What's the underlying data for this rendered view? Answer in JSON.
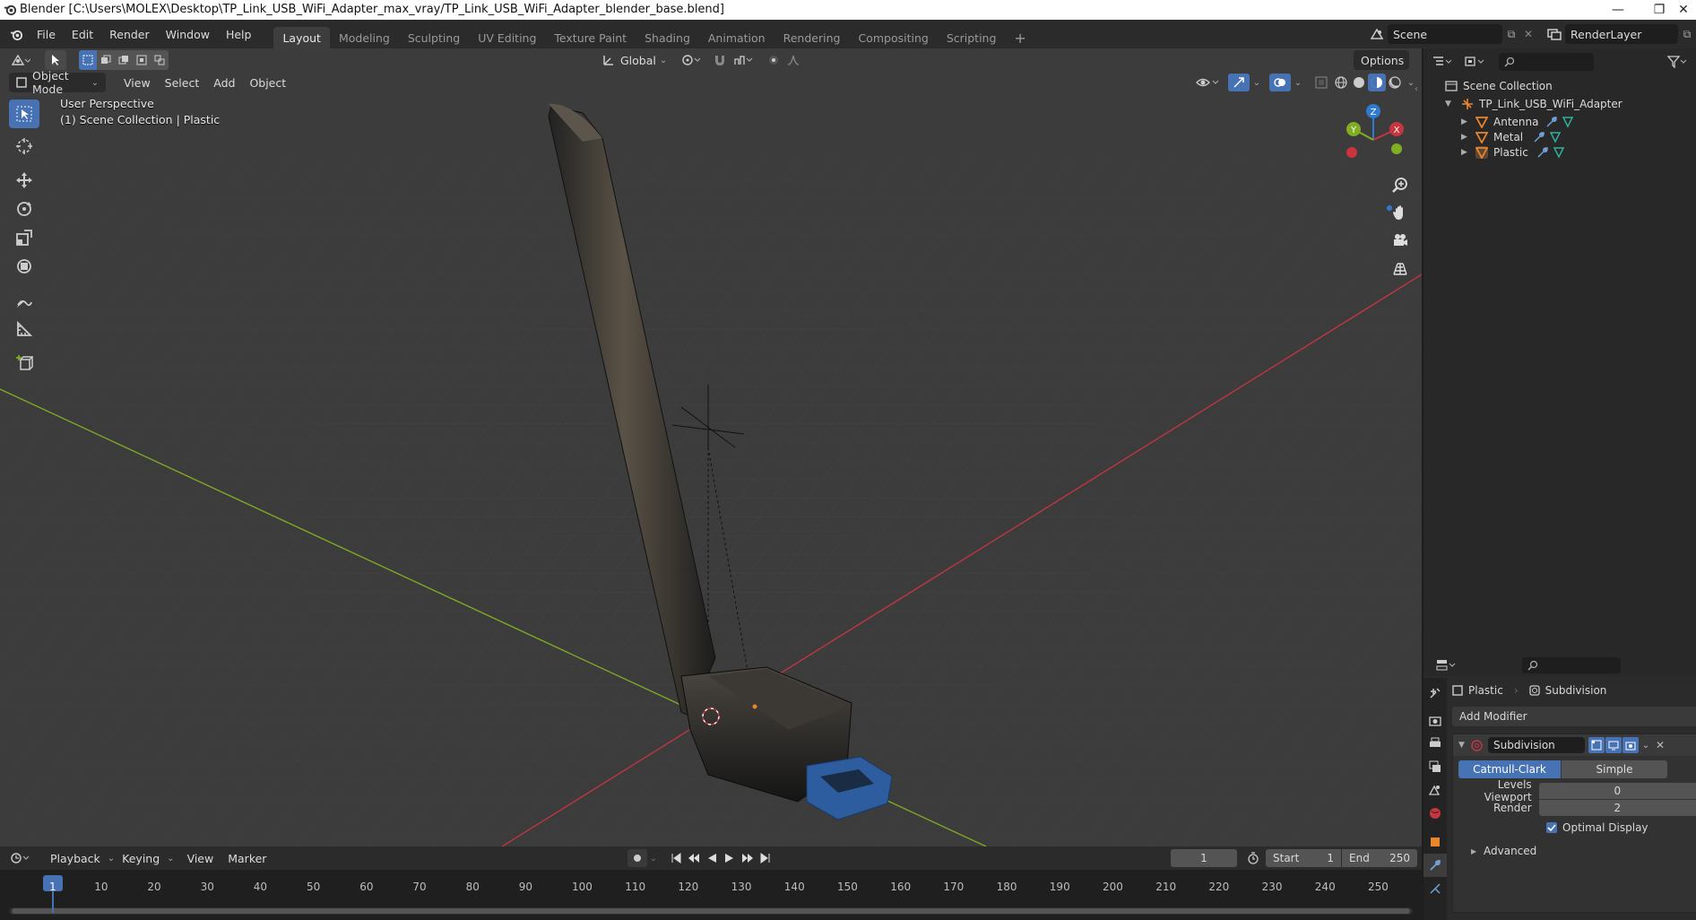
{
  "window": {
    "title": "Blender [C:\\Users\\MOLEX\\Desktop\\TP_Link_USB_WiFi_Adapter_max_vray/TP_Link_USB_WiFi_Adapter_blender_base.blend]",
    "minimize": "—",
    "restore": "❐",
    "close": "✕"
  },
  "menu": [
    "File",
    "Edit",
    "Render",
    "Window",
    "Help"
  ],
  "workspaces": [
    "Layout",
    "Modeling",
    "Sculpting",
    "UV Editing",
    "Texture Paint",
    "Shading",
    "Animation",
    "Rendering",
    "Compositing",
    "Scripting"
  ],
  "active_workspace": "Layout",
  "add_workspace": "+",
  "scene": "Scene",
  "render_layer": "RenderLayer",
  "header": {
    "transform_orientation": "Global",
    "options": "Options"
  },
  "viewport_header": {
    "mode": "Object Mode",
    "menus": [
      "View",
      "Select",
      "Add",
      "Object"
    ]
  },
  "viewport_overlay": {
    "perspective": "User Perspective",
    "collection": "(1) Scene Collection | Plastic"
  },
  "gizmo": {
    "z": "Z",
    "y": "Y",
    "x": "X"
  },
  "outliner": {
    "root": "Scene Collection",
    "collection": "TP_Link_USB_WiFi_Adapter",
    "objects": [
      "Antenna",
      "Metal",
      "Plastic"
    ]
  },
  "properties": {
    "object": "Plastic",
    "modifier_crumb": "Subdivision",
    "add_modifier": "Add Modifier",
    "modifier_name": "Subdivision",
    "algorithms": [
      "Catmull-Clark",
      "Simple"
    ],
    "active_algorithm": "Catmull-Clark",
    "levels_viewport_label": "Levels Viewport",
    "levels_viewport": "0",
    "render_label": "Render",
    "render": "2",
    "optimal_display": "Optimal Display",
    "advanced": "Advanced"
  },
  "timeline": {
    "menus": [
      "Playback",
      "Keying",
      "View",
      "Marker"
    ],
    "current_frame": "1",
    "start_label": "Start",
    "start": "1",
    "end_label": "End",
    "end": "250",
    "ruler": [
      "1",
      "10",
      "20",
      "30",
      "40",
      "50",
      "60",
      "70",
      "80",
      "90",
      "100",
      "110",
      "120",
      "130",
      "140",
      "150",
      "160",
      "170",
      "180",
      "190",
      "200",
      "210",
      "220",
      "230",
      "240",
      "250"
    ]
  },
  "colors": {
    "accent": "#4772b3",
    "x_axis": "#c9353f",
    "y_axis": "#7fae23",
    "z_axis": "#2f7ad1",
    "object_orange": "#e8862d"
  }
}
